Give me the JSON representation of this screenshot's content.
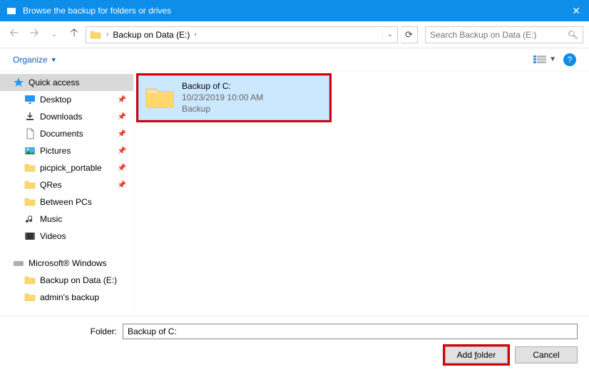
{
  "title": "Browse the backup for folders or drives",
  "breadcrumb": {
    "root": "Backup on Data (E:)"
  },
  "search": {
    "placeholder": "Search Backup on Data (E:)"
  },
  "toolbar": {
    "organize": "Organize"
  },
  "tree": {
    "quick_access": "Quick access",
    "items": [
      {
        "icon": "desktop",
        "label": "Desktop",
        "pinned": true
      },
      {
        "icon": "download",
        "label": "Downloads",
        "pinned": true
      },
      {
        "icon": "document",
        "label": "Documents",
        "pinned": true
      },
      {
        "icon": "picture",
        "label": "Pictures",
        "pinned": true
      },
      {
        "icon": "folder",
        "label": "picpick_portable",
        "pinned": true
      },
      {
        "icon": "folder",
        "label": "QRes",
        "pinned": true
      },
      {
        "icon": "folder",
        "label": "Between PCs",
        "pinned": false
      },
      {
        "icon": "music",
        "label": "Music",
        "pinned": false
      },
      {
        "icon": "video",
        "label": "Videos",
        "pinned": false
      }
    ],
    "section2": {
      "label": "Microsoft® Windows",
      "items": [
        {
          "label": "Backup on Data (E:)"
        },
        {
          "label": "admin's backup"
        }
      ]
    }
  },
  "content": {
    "item": {
      "name": "Backup of C:",
      "date": "10/23/2019 10:00 AM",
      "type": "Backup"
    }
  },
  "footer": {
    "folder_label": "Folder:",
    "folder_value": "Backup of C:",
    "add": "Add folder",
    "cancel": "Cancel"
  }
}
